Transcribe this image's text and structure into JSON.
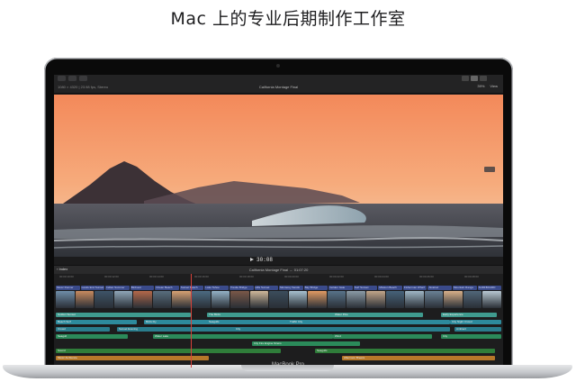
{
  "headline": "Mac 上的专业后期制作工作室",
  "device_label": "MacBook Pro",
  "app": {
    "project_title": "California Montage Final",
    "top_info": "1080 × 4320 | 23.98 fps, Stereo",
    "zoom": "39%",
    "view_label": "View",
    "timecode": "30:08",
    "timeline_title": "California Montage Final",
    "timeline_duration": "01:07:20",
    "index_label": "Index"
  },
  "ruler_marks": [
    "00:00:10:00",
    "00:00:12:00",
    "00:00:14:00",
    "00:00:16:00",
    "00:00:18:00",
    "00:00:20:00",
    "00:00:22:00",
    "00:00:24:00",
    "00:00:26:00",
    "00:00:28:00"
  ],
  "title_clips": [
    "Music Runner",
    "Lands End Sunset",
    "Indian Summer",
    "Birdnest",
    "Ocean Beach",
    "Sunset Beach",
    "Lake Tahoe",
    "Trestle Bridge",
    "Hills Sunset",
    "Monterey Sands",
    "Bay Bridge",
    "Golden Gate",
    "Surf Sunset",
    "Mission Beach",
    "Fisherman Wharf",
    "Alcatraz",
    "Mountain Range",
    "SURFBOARD"
  ],
  "tracks": [
    {
      "label": "Golden Sunset",
      "color": "#3f9b8f"
    },
    {
      "label": "Water Pine",
      "color": "#3f9b8f"
    },
    {
      "label": "Early Experience",
      "color": "#3f9b8f"
    },
    {
      "label": "The Birds",
      "color": "#3f9b8f"
    },
    {
      "label": "Beach Surf",
      "color": "#2d8a9c"
    },
    {
      "label": "Birds Fly",
      "color": "#2d8a9c"
    },
    {
      "label": "Seagulls",
      "color": "#2d8a9c"
    },
    {
      "label": "Traffic City",
      "color": "#2d8a9c"
    },
    {
      "label": "City Night Crowd",
      "color": "#2d8a9c"
    },
    {
      "label": "Crowd",
      "color": "#2a7d8d"
    },
    {
      "label": "Sunset Evening",
      "color": "#2a7d8d"
    },
    {
      "label": "City",
      "color": "#2a7d8d"
    },
    {
      "label": "Ambient",
      "color": "#2a7d8d"
    },
    {
      "label": "Seagull",
      "color": "#2b8a5a"
    },
    {
      "label": "Water Lake",
      "color": "#2b8a5a"
    },
    {
      "label": "Wind",
      "color": "#2b8a5a"
    },
    {
      "label": "City",
      "color": "#2b8a5a"
    },
    {
      "label": "City Fire Engine Sirens",
      "color": "#2b8a5a"
    },
    {
      "label": "Sound",
      "color": "#2f7d3a"
    },
    {
      "label": "Seagulls",
      "color": "#2f7d3a"
    },
    {
      "label": "Music Ambience",
      "color": "#b7782a"
    },
    {
      "label": "Afternoon Breeze",
      "color": "#b7782a"
    }
  ],
  "colors": {
    "sky_top": "#f49a5f",
    "sky_bottom": "#f7c7a1",
    "mountain": "#3a3035",
    "ocean": "#4a4d55",
    "playhead": "#d8413a"
  }
}
